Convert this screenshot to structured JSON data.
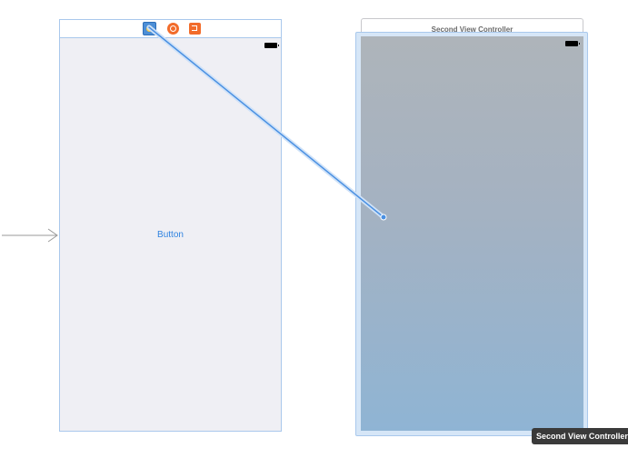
{
  "canvas": {
    "first_scene": {
      "button_label": "Button",
      "dock_icons": [
        "view-controller-icon",
        "first-responder-icon",
        "exit-icon"
      ]
    },
    "second_scene": {
      "title": "Second View Controller"
    },
    "tooltip": "Second View Controller"
  },
  "colors": {
    "selection_blue": "#4a90e2",
    "button_text": "#2f83e0",
    "dock_orange": "#f26c2b",
    "canvas_background": "#efeff4"
  }
}
